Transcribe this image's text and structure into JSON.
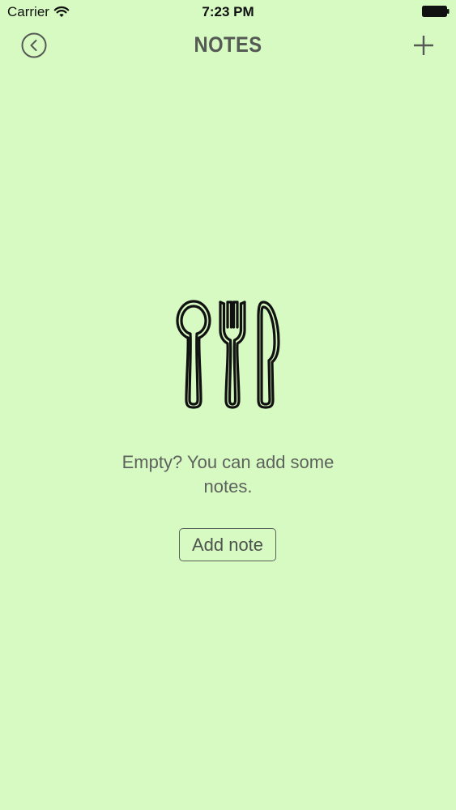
{
  "status_bar": {
    "carrier": "Carrier",
    "time": "7:23 PM",
    "wifi_icon": "wifi-icon",
    "battery_icon": "battery-full-icon"
  },
  "nav": {
    "title": "NOTES",
    "back_icon": "circle-chevron-left-icon",
    "add_icon": "plus-icon"
  },
  "empty_state": {
    "icon": "cutlery-icon",
    "message": "Empty? You can add some notes.",
    "add_button_label": "Add note"
  },
  "colors": {
    "background": "#d6fac2",
    "title": "#555a55",
    "message": "#5d625d"
  }
}
